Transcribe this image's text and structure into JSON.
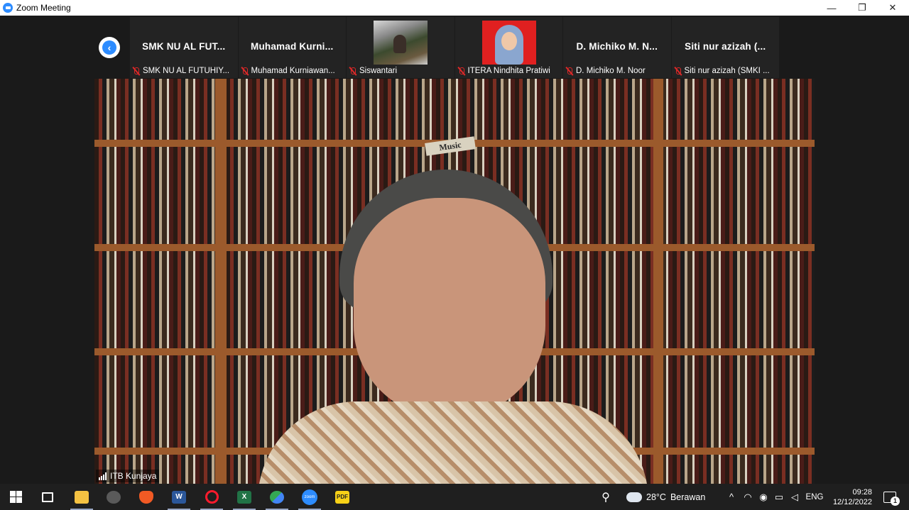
{
  "window": {
    "title": "Zoom Meeting",
    "minimize_glyph": "—",
    "maximize_glyph": "❐",
    "close_glyph": "✕"
  },
  "gallery": {
    "prev_page_glyph": "‹",
    "thumbnails": [
      {
        "title": "SMK NU AL FUT...",
        "label": "SMK NU AL FUTUHIY...",
        "muted": true,
        "video": false
      },
      {
        "title": "Muhamad Kurni...",
        "label": "Muhamad Kurniawan...",
        "muted": true,
        "video": false
      },
      {
        "title": "",
        "label": "Siswantari",
        "muted": true,
        "video": true
      },
      {
        "title": "",
        "label": "ITERA Nindhita Pratiwi",
        "muted": true,
        "video": true
      },
      {
        "title": "D. Michiko M. N...",
        "label": "D. Michiko M. Noor",
        "muted": true,
        "video": false
      },
      {
        "title": "Siti nur azizah (...",
        "label": "Siti nur azizah (SMKI ...",
        "muted": true,
        "video": false
      }
    ]
  },
  "main_video": {
    "speaker_name": "ITB Kunjaya",
    "shelf_tag": "Music"
  },
  "taskbar": {
    "apps": [
      {
        "name": "file-explorer",
        "label": "",
        "active": true
      },
      {
        "name": "control",
        "label": "",
        "active": false
      },
      {
        "name": "brave",
        "label": "",
        "active": false
      },
      {
        "name": "word",
        "label": "W",
        "active": true
      },
      {
        "name": "opera",
        "label": "",
        "active": true
      },
      {
        "name": "excel",
        "label": "X",
        "active": true
      },
      {
        "name": "maps",
        "label": "",
        "active": true
      },
      {
        "name": "zoom",
        "label": "zoom",
        "active": true
      },
      {
        "name": "pdf",
        "label": "PDF",
        "active": false
      }
    ],
    "weather": {
      "temperature": "28°C",
      "condition": "Berawan"
    },
    "language": "ENG",
    "time": "09:28",
    "date": "12/12/2022",
    "notifications": "1",
    "colors": {
      "accent": "#2d8cff",
      "muted_mic": "#e02828",
      "taskbar_bg": "#1f1f1f"
    }
  }
}
